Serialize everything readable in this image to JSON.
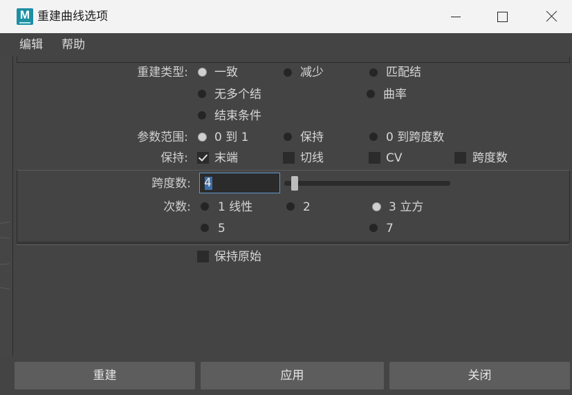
{
  "window": {
    "title": "重建曲线选项",
    "app_icon_letter": "M"
  },
  "menu": [
    "编辑",
    "帮助"
  ],
  "rebuild_type": {
    "label": "重建类型:",
    "options": [
      "一致",
      "减少",
      "匹配结",
      "无多个结",
      "曲率",
      "结束条件"
    ],
    "selected": "一致"
  },
  "parameter_range": {
    "label": "参数范围:",
    "options": [
      "0 到 1",
      "保持",
      "0 到跨度数"
    ],
    "selected": "0 到 1"
  },
  "keep": {
    "label": "保持:",
    "options": [
      {
        "label": "末端",
        "checked": true
      },
      {
        "label": "切线",
        "checked": false
      },
      {
        "label": "CV",
        "checked": false
      },
      {
        "label": "跨度数",
        "checked": false
      }
    ]
  },
  "spans": {
    "label": "跨度数:",
    "value": "4"
  },
  "degree": {
    "label": "次数:",
    "options": [
      "1 线性",
      "2",
      "3 立方",
      "5",
      "7"
    ],
    "selected": "3 立方"
  },
  "keep_original": {
    "label": "保持原始",
    "checked": false
  },
  "buttons": {
    "rebuild": "重建",
    "apply": "应用",
    "close": "关闭"
  }
}
